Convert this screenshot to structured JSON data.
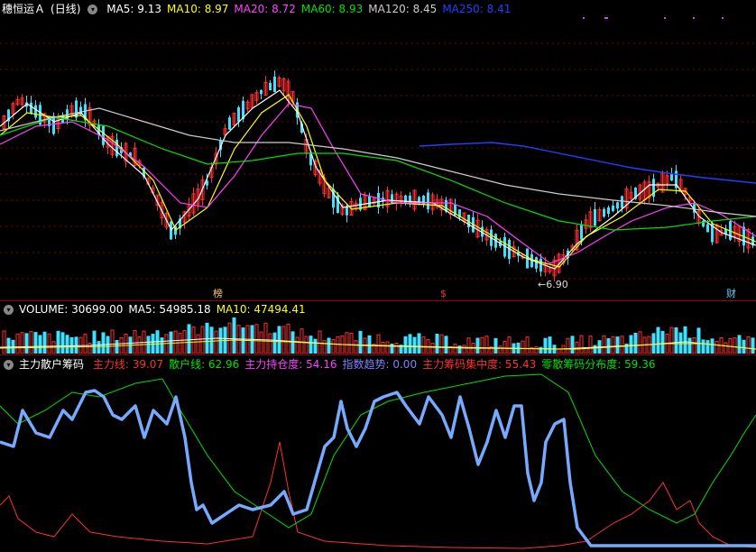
{
  "main": {
    "stock_name": "穗恒运Ａ",
    "period": "(日线)",
    "ma": [
      {
        "label": "MA5: 9.13",
        "color": "#ffffff"
      },
      {
        "label": "MA10: 8.97",
        "color": "#ffff00"
      },
      {
        "label": "MA20: 8.72",
        "color": "#ff40ff"
      },
      {
        "label": "MA60: 8.93",
        "color": "#00e000"
      },
      {
        "label": "MA120: 8.45",
        "color": "#cccccc"
      },
      {
        "label": "MA250: 8.41",
        "color": "#2040ff"
      }
    ],
    "low_marker": "6.90",
    "tags": [
      {
        "text": "榜",
        "color": "#ffcc66"
      },
      {
        "text": "$",
        "color": "#ff3030"
      },
      {
        "text": "财",
        "color": "#66ccff"
      }
    ]
  },
  "volume": {
    "label": "VOLUME: 30699.00",
    "ma5": "MA5: 54985.18",
    "ma10": "MA10: 47494.41"
  },
  "indicator": {
    "name": "主力散户筹码",
    "lines": [
      {
        "label": "主力线: 39.07",
        "color": "#ff3030"
      },
      {
        "label": "散户线: 62.96",
        "color": "#00e000"
      },
      {
        "label": "主力持仓度: 54.16",
        "color": "#ff40ff"
      },
      {
        "label": "指数趋势: 0.00",
        "color": "#8080ff"
      },
      {
        "label": "主力筹码集中度: 55.43",
        "color": "#ff3030"
      },
      {
        "label": "零散筹码分布度: 59.36",
        "color": "#00e000"
      }
    ]
  },
  "colors": {
    "up": "#ff3030",
    "down": "#40e0ff",
    "grid": "#800000",
    "main_line": "#77aaff"
  }
}
